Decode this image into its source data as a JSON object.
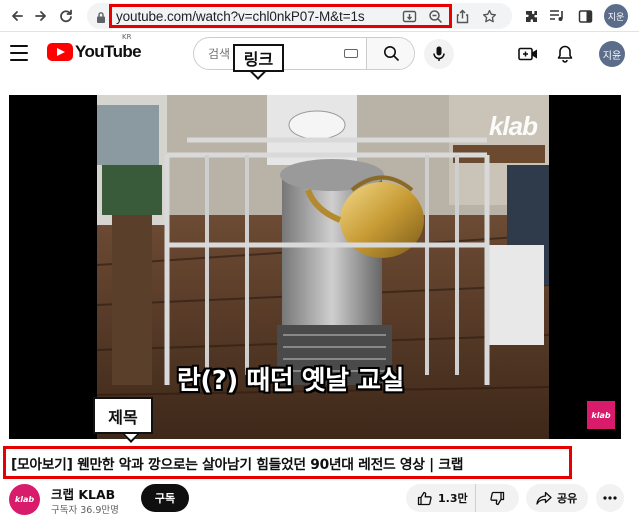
{
  "browser": {
    "url": "youtube.com/watch?v=chl0nkP07-M&t=1s",
    "profile_initials": "지운"
  },
  "header": {
    "logo_text": "YouTube",
    "region_code": "KR",
    "search_placeholder": "검색",
    "avatar_initials": "지윤"
  },
  "annotations": {
    "link_label": "링크",
    "title_label": "제목",
    "highlight_color": "#e60000"
  },
  "video": {
    "watermark": "klab",
    "corner_logo": "klab",
    "subtitle": "란(?) 때던 옛날 교실"
  },
  "meta": {
    "title": "[모아보기] 웬만한 악과 깡으로는 살아남기 힘들었던 90년대 레전드 영상 | 크랩",
    "channel_name": "크랩 KLAB",
    "channel_avatar_text": "klab",
    "subscribers": "구독자 36.9만명",
    "subscribe_label": "구독",
    "likes": "1.3만",
    "share_label": "공유"
  },
  "colors": {
    "brand_red": "#ff0000",
    "klab_pink": "#d81b6b"
  }
}
